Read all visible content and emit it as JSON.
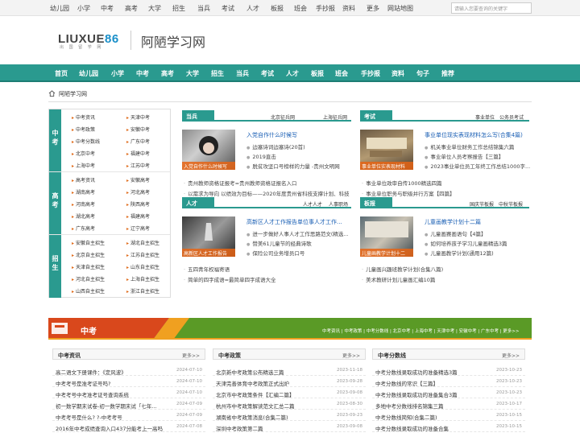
{
  "topbar": {
    "links": [
      "幼儿园",
      "小学",
      "中考",
      "高考",
      "大学",
      "招生",
      "当兵",
      "考试",
      "人才",
      "板报",
      "班会",
      "手抄报",
      "资料",
      "更多",
      "网站地图"
    ],
    "search_placeholder": "请输入您要查询的关键字"
  },
  "logo": {
    "text_main": "LIUXUE",
    "text_accent": "86",
    "sub": "出 国 留 学 网",
    "site_name": "阿陋学习网"
  },
  "nav": {
    "items": [
      "首页",
      "幼儿园",
      "小学",
      "中考",
      "高考",
      "大学",
      "招生",
      "当兵",
      "考试",
      "人才",
      "板报",
      "班会",
      "手抄报",
      "资料",
      "句子",
      "推荐"
    ]
  },
  "breadcrumb": {
    "home": "阿陋学习网"
  },
  "left_groups": [
    {
      "head": "中考",
      "items": [
        "中考资讯",
        "天津中考",
        "中考政策",
        "安徽中考",
        "中考分数线",
        "广东中考",
        "北京中考",
        "福建中考",
        "上海中考",
        "江苏中考"
      ]
    },
    {
      "head": "高考",
      "items": [
        "高考资讯",
        "安徽高考",
        "湖南高考",
        "河北高考",
        "河南高考",
        "陕西高考",
        "湖北高考",
        "福建高考",
        "广东高考",
        "辽宁高考"
      ]
    },
    {
      "head": "招生",
      "items": [
        "安徽自主招生",
        "湖北自主招生",
        "北京自主招生",
        "江苏自主招生",
        "天津自主招生",
        "山东自主招生",
        "河北自主招生",
        "上海自主招生",
        "山西自主招生",
        "浙江自主招生"
      ]
    }
  ],
  "panels": {
    "dangbing": {
      "title": "当兵",
      "links": [
        "北京征兵网",
        "上海征兵网"
      ],
      "img_caption": "入党自作什么时候写",
      "lead": "入党自作什么时候写",
      "items": [
        "边塞诗词边塞诗(20首)",
        "2019直击",
        "脱贫攻坚口号榜样的力量 -贵州文明网"
      ],
      "list": [
        "贵州教师资格证报考=贵州教师资格证报名入口",
        "以需求为导向 以绩效为目标——2020年度贵州省科技支撑计划、科技"
      ]
    },
    "kaoshi": {
      "title": "考试",
      "links": [
        "事业单位",
        "公务员考试"
      ],
      "img_caption": "事业单位实表现材料",
      "lead": "事业单位现实表现材料怎么写(合集4篇)",
      "items": [
        "机关事业单位财务工作总结锦集六篇",
        "事业单位人员考察报告【三篇】",
        "2023事业单位员工年终工作总结1000字..."
      ],
      "list": [
        "事业单位政审自传1000精选四篇",
        "事业单位职务与职级并行方案【四篇】"
      ]
    },
    "rencai": {
      "title": "人才",
      "links": [
        "人才人才",
        "人事职场"
      ],
      "img_caption": "高新区人才工作报告",
      "lead": "高新区人才工作报告单位事人才工作...",
      "items": [
        "进一步做好人事人才工作思路范文(精选...",
        "赞美61儿童节的经典诗歌",
        "保险公司业务增员口号"
      ],
      "list": [
        "五四青年权福寄语",
        "简单的四字成语=最简单四字成语大全"
      ]
    },
    "banbao": {
      "title": "板报",
      "links": [
        "国庆节板报",
        "中秋节板报"
      ],
      "img_caption": "儿童画教学计划十二",
      "lead": "儿童画教学计划十二篇",
      "items": [
        "儿童画赛画语句【4篇】",
        "如何培养孩子学习儿童画精选3篇",
        "儿童画教学计划(通用12篇)"
      ],
      "list": [
        "儿童画兴趣班教学计划(合集八篇)",
        "美术教研计划儿童画汇编10篇"
      ]
    }
  },
  "banner": {
    "title": "中考",
    "links": "中考资讯 | 中考政策 | 中考分数线 | 北京中考 | 上海中考 | 天津中考 | 安徽中考 | 广东中考 | 更多>>"
  },
  "columns": [
    {
      "title": "中考资讯",
      "more": "更多>>",
      "rows": [
        {
          "t": "高二语文下册课件：《定风波》",
          "d": "2024-07-10"
        },
        {
          "t": "中考考号是准考证号吗?",
          "d": "2024-07-10"
        },
        {
          "t": "中考考号中考准考证号查询系统",
          "d": "2024-07-10"
        },
        {
          "t": "初一数学期末试卷-初一数学期末试「七年...",
          "d": "2024-07-09"
        },
        {
          "t": "中考考号是什么? ?-中考考号",
          "d": "2024-07-09"
        },
        {
          "t": "2016年中考成绩查询入口437分能考上一高吗",
          "d": "2024-07-08"
        }
      ]
    },
    {
      "title": "中考政策",
      "more": "更多>>",
      "rows": [
        {
          "t": "北京新中考政策公布精选三篇",
          "d": "2023-11-18"
        },
        {
          "t": "天津完善体育中考政策正式出炉",
          "d": "2023-09-28"
        },
        {
          "t": "北京市中考政策条件【汇编二篇】",
          "d": "2023-09-08"
        },
        {
          "t": "杭州市中考政策解读范文汇总二篇",
          "d": "2023-08-30"
        },
        {
          "t": "湖南省中考政策消息(合集二篇)",
          "d": "2023-09-23"
        },
        {
          "t": "深圳中考政策第二篇",
          "d": "2023-09-08"
        }
      ]
    },
    {
      "title": "中考分数线",
      "more": "更多>>",
      "rows": [
        {
          "t": "中考分数线录取成功的准备精选3篇",
          "d": "2023-10-23"
        },
        {
          "t": "中考分数线的常识【三篇】",
          "d": "2023-10-23"
        },
        {
          "t": "中考分数线录取成功的准备集合3篇",
          "d": "2023-10-23"
        },
        {
          "t": "多地中考分数线排名锦集三篇",
          "d": "2023-10-17"
        },
        {
          "t": "中考分数线简知(合集二篇)",
          "d": "2023-10-15"
        },
        {
          "t": "中考分数线录取成功的准备合集",
          "d": "2023-10-15"
        }
      ]
    }
  ]
}
